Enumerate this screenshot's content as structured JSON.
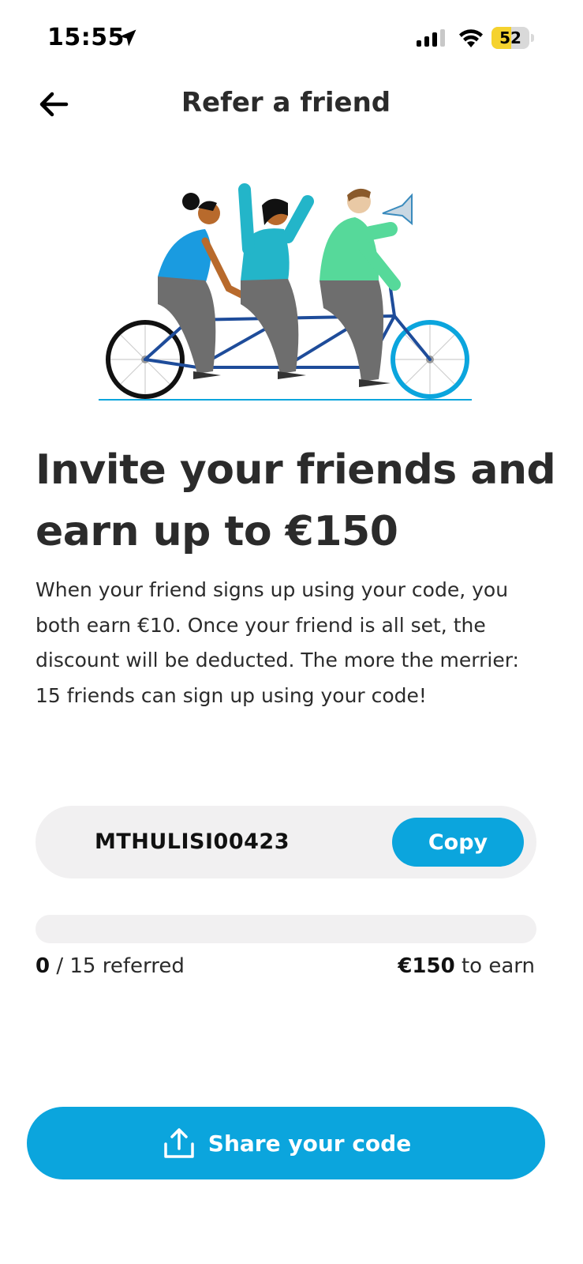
{
  "status_bar": {
    "time": "15:55",
    "battery": "52",
    "battery_level": 0.52,
    "icons": [
      "location-arrow-icon",
      "cellular-signal-icon",
      "wifi-icon",
      "battery-icon"
    ]
  },
  "header": {
    "title": "Refer a friend",
    "back_icon": "arrow-left-icon"
  },
  "illustration": {
    "description_icon": "tandem-bicycle-illustration"
  },
  "hero": {
    "title": "Invite your friends and earn up to €150",
    "body": "When your friend signs up using your code, you both earn €10. Once your friend is all set, the discount will be deducted. The more the merrier: 15 friends can sign up using your code!"
  },
  "referral": {
    "code": "MTHULISI00423",
    "copy_label": "Copy"
  },
  "progress": {
    "referred_count": "0",
    "referred_suffix": "/ 15 referred",
    "earn_amount": "€150",
    "earn_suffix": "to earn",
    "fraction": 0
  },
  "share": {
    "label": "Share your code",
    "icon": "share-upload-icon"
  },
  "colors": {
    "accent": "#0ba5dd",
    "card_bg": "#f1f0f1",
    "text": "#2b2b2b",
    "battery_yellow": "#f5d22e"
  }
}
